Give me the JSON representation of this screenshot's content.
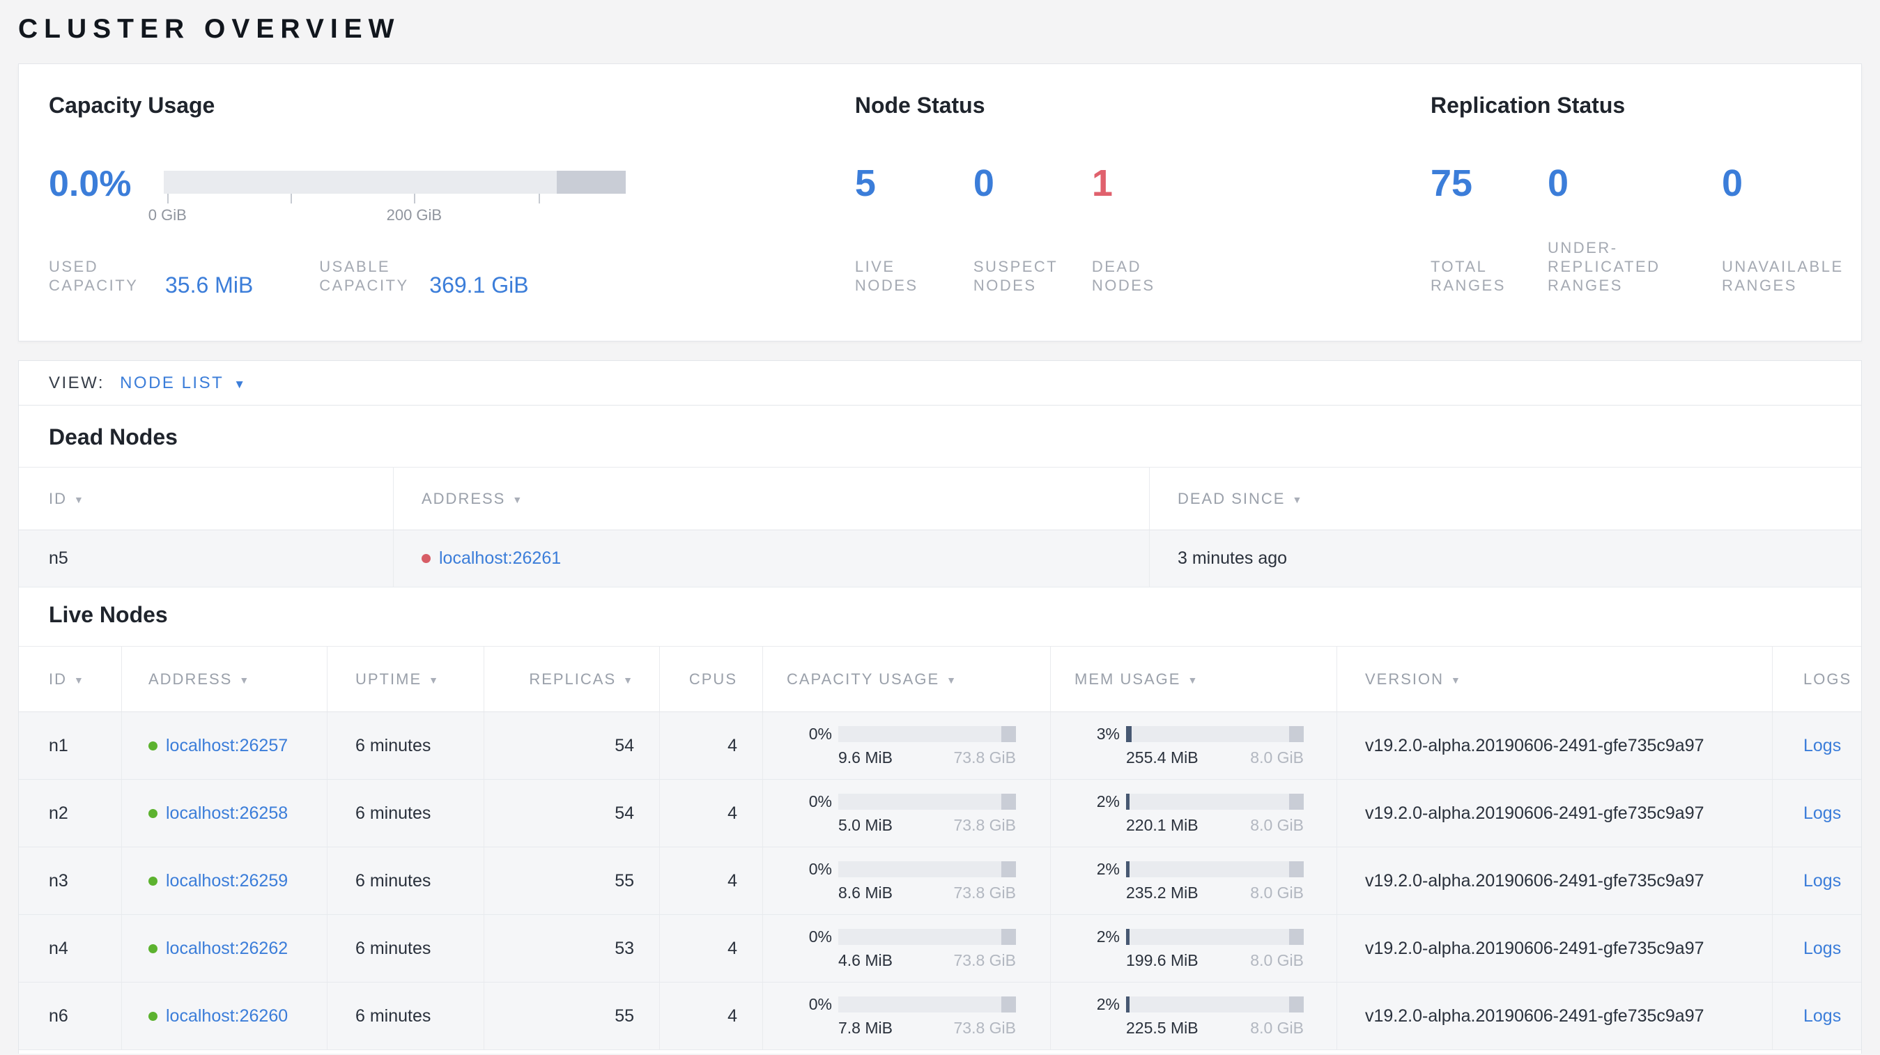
{
  "page": {
    "title": "CLUSTER OVERVIEW"
  },
  "colors": {
    "accent": "#3b7dd9",
    "danger": "#e0616d",
    "healthy_dot": "#5cb22f",
    "dead_dot": "#d75d66"
  },
  "icons": {
    "sort_desc": "▼",
    "dropdown_caret": "▼"
  },
  "summary": {
    "capacity": {
      "heading": "Capacity Usage",
      "percent": "0.0%",
      "tick_labels": [
        "0 GiB",
        "200 GiB"
      ],
      "used": {
        "label": "USED CAPACITY",
        "value": "35.6 MiB"
      },
      "usable": {
        "label": "USABLE CAPACITY",
        "value": "369.1 GiB"
      }
    },
    "node_status": {
      "heading": "Node Status",
      "stats": [
        {
          "value": "5",
          "label": "LIVE NODES"
        },
        {
          "value": "0",
          "label": "SUSPECT NODES"
        },
        {
          "value": "1",
          "label": "DEAD NODES"
        }
      ]
    },
    "replication": {
      "heading": "Replication Status",
      "stats": [
        {
          "value": "75",
          "label": "TOTAL RANGES"
        },
        {
          "value": "0",
          "label": "UNDER-REPLICATED RANGES"
        },
        {
          "value": "0",
          "label": "UNAVAILABLE RANGES"
        }
      ]
    }
  },
  "view_bar": {
    "label": "VIEW:",
    "selected": "NODE LIST"
  },
  "dead_nodes": {
    "heading": "Dead Nodes",
    "columns": {
      "id": "ID",
      "address": "ADDRESS",
      "dead_since": "DEAD SINCE"
    },
    "rows": [
      {
        "id": "n5",
        "address": "localhost:26261",
        "dead_since": "3 minutes ago"
      }
    ]
  },
  "live_nodes": {
    "heading": "Live Nodes",
    "columns": {
      "id": "ID",
      "address": "ADDRESS",
      "uptime": "UPTIME",
      "replicas": "REPLICAS",
      "cpus": "CPUS",
      "capacity": "CAPACITY USAGE",
      "mem": "MEM USAGE",
      "version": "VERSION",
      "logs": "LOGS"
    },
    "rows": [
      {
        "id": "n1",
        "address": "localhost:26257",
        "uptime": "6 minutes",
        "replicas": "54",
        "cpus": "4",
        "capacity": {
          "percent": "0%",
          "used": "9.6 MiB",
          "total": "73.8 GiB",
          "fill_pct": 0
        },
        "mem": {
          "percent": "3%",
          "used": "255.4 MiB",
          "total": "8.0 GiB",
          "fill_pct": 3
        },
        "version": "v19.2.0-alpha.20190606-2491-gfe735c9a97",
        "logs_label": "Logs"
      },
      {
        "id": "n2",
        "address": "localhost:26258",
        "uptime": "6 minutes",
        "replicas": "54",
        "cpus": "4",
        "capacity": {
          "percent": "0%",
          "used": "5.0 MiB",
          "total": "73.8 GiB",
          "fill_pct": 0
        },
        "mem": {
          "percent": "2%",
          "used": "220.1 MiB",
          "total": "8.0 GiB",
          "fill_pct": 2
        },
        "version": "v19.2.0-alpha.20190606-2491-gfe735c9a97",
        "logs_label": "Logs"
      },
      {
        "id": "n3",
        "address": "localhost:26259",
        "uptime": "6 minutes",
        "replicas": "55",
        "cpus": "4",
        "capacity": {
          "percent": "0%",
          "used": "8.6 MiB",
          "total": "73.8 GiB",
          "fill_pct": 0
        },
        "mem": {
          "percent": "2%",
          "used": "235.2 MiB",
          "total": "8.0 GiB",
          "fill_pct": 2
        },
        "version": "v19.2.0-alpha.20190606-2491-gfe735c9a97",
        "logs_label": "Logs"
      },
      {
        "id": "n4",
        "address": "localhost:26262",
        "uptime": "6 minutes",
        "replicas": "53",
        "cpus": "4",
        "capacity": {
          "percent": "0%",
          "used": "4.6 MiB",
          "total": "73.8 GiB",
          "fill_pct": 0
        },
        "mem": {
          "percent": "2%",
          "used": "199.6 MiB",
          "total": "8.0 GiB",
          "fill_pct": 2
        },
        "version": "v19.2.0-alpha.20190606-2491-gfe735c9a97",
        "logs_label": "Logs"
      },
      {
        "id": "n6",
        "address": "localhost:26260",
        "uptime": "6 minutes",
        "replicas": "55",
        "cpus": "4",
        "capacity": {
          "percent": "0%",
          "used": "7.8 MiB",
          "total": "73.8 GiB",
          "fill_pct": 0
        },
        "mem": {
          "percent": "2%",
          "used": "225.5 MiB",
          "total": "8.0 GiB",
          "fill_pct": 2
        },
        "version": "v19.2.0-alpha.20190606-2491-gfe735c9a97",
        "logs_label": "Logs"
      }
    ]
  }
}
